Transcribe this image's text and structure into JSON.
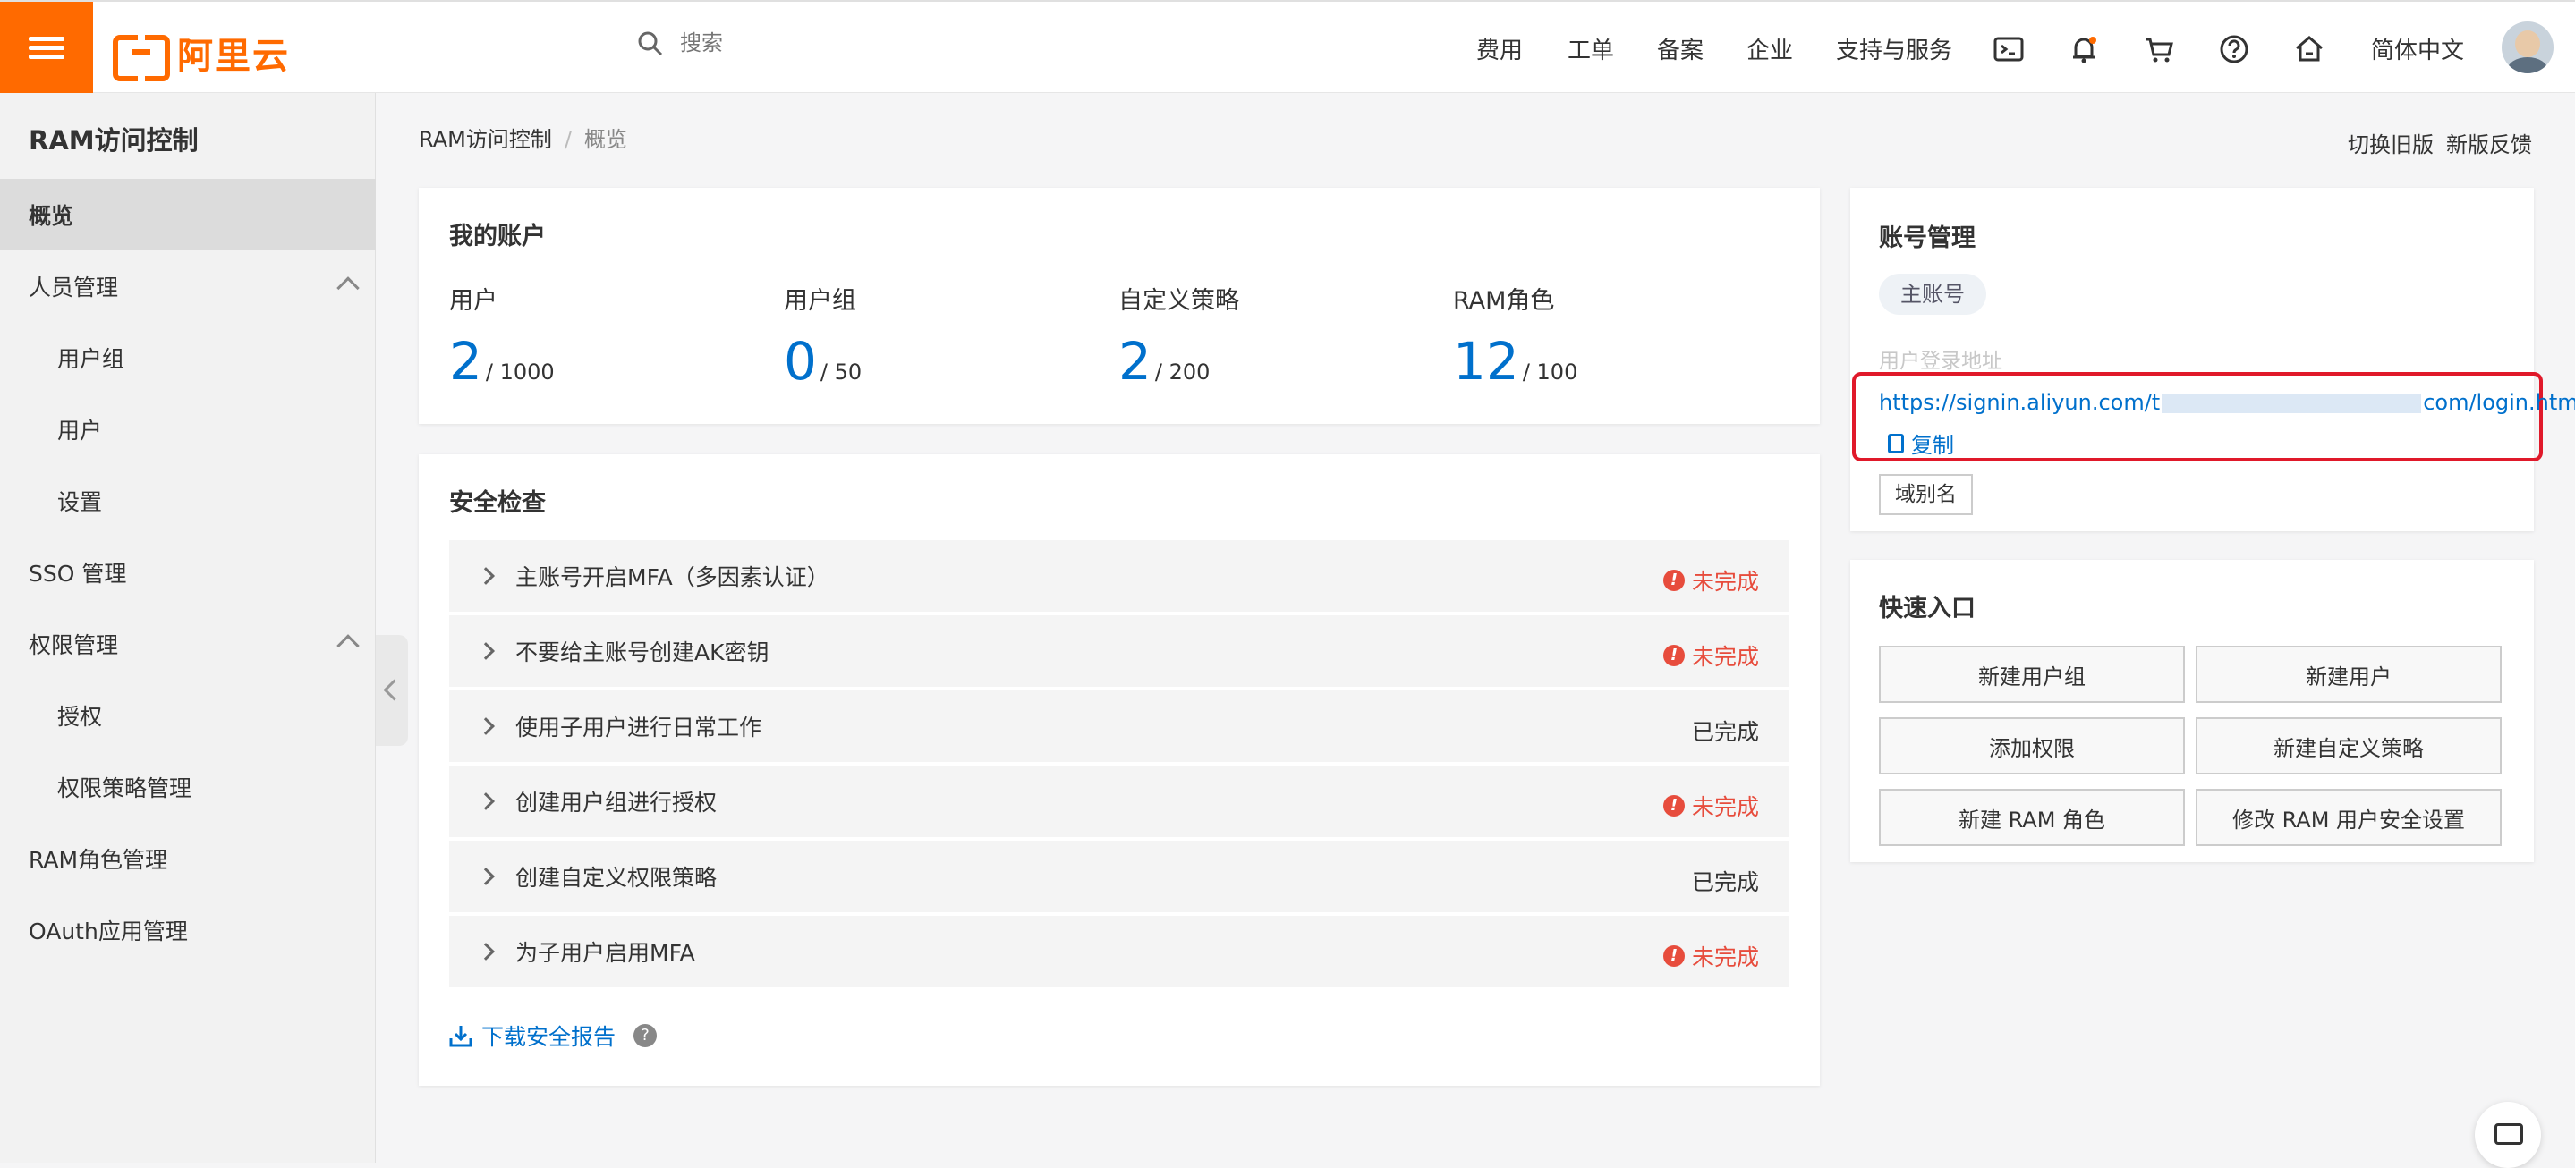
{
  "header": {
    "logo_text": "阿里云",
    "search_placeholder": "搜索",
    "nav": [
      "费用",
      "工单",
      "备案",
      "企业",
      "支持与服务"
    ],
    "icons": [
      "terminal-icon",
      "bell-icon",
      "cart-icon",
      "help-icon",
      "home-icon"
    ],
    "language": "简体中文"
  },
  "sidebar": {
    "title": "RAM访问控制",
    "items": [
      {
        "label": "概览",
        "active": true
      },
      {
        "label": "人员管理",
        "expandable": true
      },
      {
        "label": "用户组",
        "sub": true
      },
      {
        "label": "用户",
        "sub": true
      },
      {
        "label": "设置",
        "sub": true
      },
      {
        "label": "SSO 管理"
      },
      {
        "label": "权限管理",
        "expandable": true
      },
      {
        "label": "授权",
        "sub": true
      },
      {
        "label": "权限策略管理",
        "sub": true
      },
      {
        "label": "RAM角色管理"
      },
      {
        "label": "OAuth应用管理"
      }
    ]
  },
  "breadcrumb": {
    "root": "RAM访问控制",
    "separator": "/",
    "current": "概览"
  },
  "actions": {
    "switch_old": "切换旧版",
    "feedback": "新版反馈"
  },
  "my_account": {
    "title": "我的账户",
    "stats": [
      {
        "label": "用户",
        "value": "2",
        "total": "/ 1000"
      },
      {
        "label": "用户组",
        "value": "0",
        "total": "/ 50"
      },
      {
        "label": "自定义策略",
        "value": "2",
        "total": "/ 200"
      },
      {
        "label": "RAM角色",
        "value": "12",
        "total": "/ 100"
      }
    ]
  },
  "security": {
    "title": "安全检查",
    "items": [
      {
        "label": "主账号开启MFA（多因素认证）",
        "status": "未完成"
      },
      {
        "label": "不要给主账号创建AK密钥",
        "status": "未完成"
      },
      {
        "label": "使用子用户进行日常工作",
        "status": "已完成"
      },
      {
        "label": "创建用户组进行授权",
        "status": "未完成"
      },
      {
        "label": "创建自定义权限策略",
        "status": "已完成"
      },
      {
        "label": "为子用户启用MFA",
        "status": "未完成"
      }
    ],
    "download": "下载安全报告"
  },
  "account_mgmt": {
    "title": "账号管理",
    "badge": "主账号",
    "login_label": "用户登录地址",
    "url_prefix": "https://signin.aliyun.com/t",
    "url_suffix": "com/login.htm",
    "copy": "复制",
    "alias": "域别名"
  },
  "quick_entry": {
    "title": "快速入口",
    "buttons": [
      "新建用户组",
      "新建用户",
      "添加权限",
      "新建自定义策略",
      "新建 RAM 角色",
      "修改 RAM 用户安全设置"
    ]
  },
  "colors": {
    "brand": "#ff6a00",
    "link": "#0070cc",
    "warning": "#e74c3c",
    "highlight": "#e0192a"
  }
}
